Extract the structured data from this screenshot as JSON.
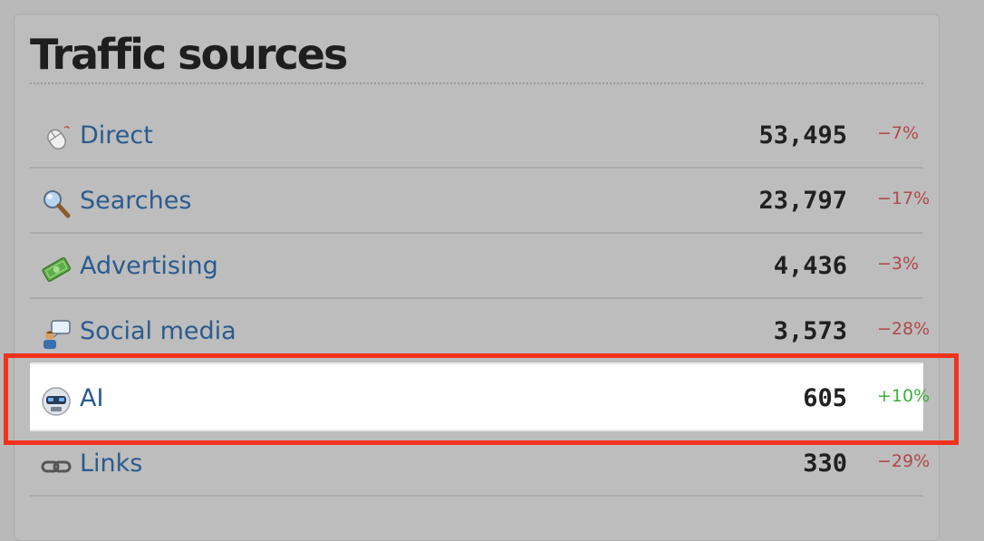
{
  "panel": {
    "title": "Traffic sources"
  },
  "sources": [
    {
      "label": "Direct",
      "count": "53,495",
      "change": "−7%",
      "trend": "down",
      "icon": "mouse-icon"
    },
    {
      "label": "Searches",
      "count": "23,797",
      "change": "−17%",
      "trend": "down",
      "icon": "magnifier-icon"
    },
    {
      "label": "Advertising",
      "count": "4,436",
      "change": "−3%",
      "trend": "down",
      "icon": "money-icon"
    },
    {
      "label": "Social media",
      "count": "3,573",
      "change": "−28%",
      "trend": "down",
      "icon": "chat-person-icon"
    },
    {
      "label": "AI",
      "count": "605",
      "change": "+10%",
      "trend": "up",
      "icon": "robot-icon",
      "highlighted": true
    },
    {
      "label": "Links",
      "count": "330",
      "change": "−29%",
      "trend": "down",
      "icon": "chain-link-icon"
    }
  ],
  "colors": {
    "negative": "#b0484b",
    "positive": "#3ab03e",
    "link": "#2a5b8f",
    "highlight_border": "#f2321c"
  }
}
